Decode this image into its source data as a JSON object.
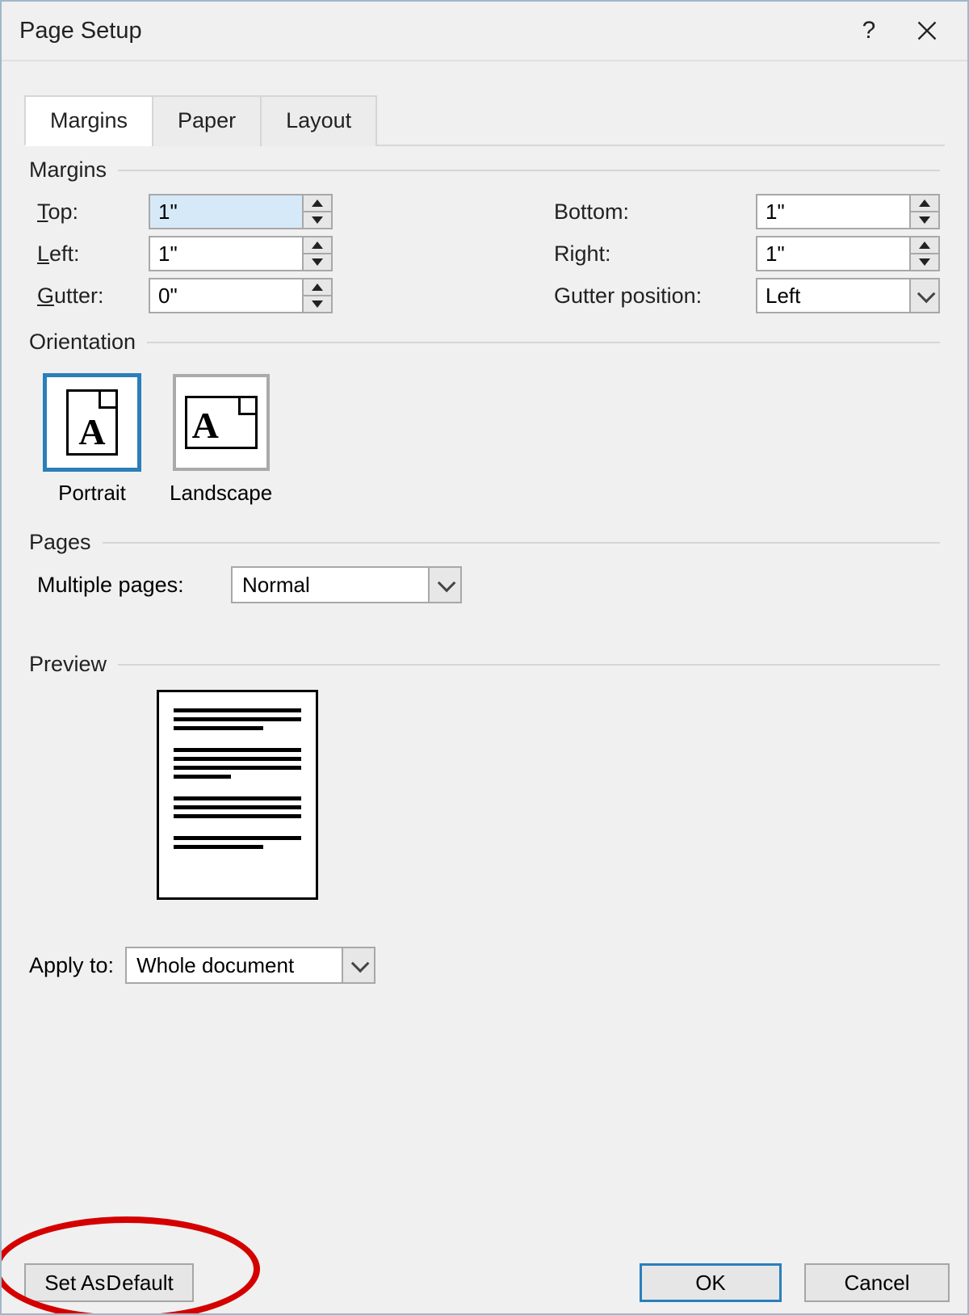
{
  "dialog": {
    "title": "Page Setup"
  },
  "tabs": [
    {
      "label": "Margins",
      "active": true
    },
    {
      "label": "Paper",
      "active": false
    },
    {
      "label": "Layout",
      "active": false
    }
  ],
  "margins": {
    "section_label": "Margins",
    "top": {
      "label_pre": "",
      "key": "T",
      "label_post": "op:",
      "value": "1\""
    },
    "bottom": {
      "label_pre": "",
      "key": "B",
      "label_post": "ottom:",
      "value": "1\""
    },
    "left": {
      "label_pre": "",
      "key": "L",
      "label_post": "eft:",
      "value": "1\""
    },
    "right": {
      "label_pre": "",
      "key": "R",
      "label_post": "ight:",
      "value": "1\""
    },
    "gutter": {
      "label_pre": "",
      "key": "G",
      "label_post": "utter:",
      "value": "0\""
    },
    "gutter_position": {
      "label": "Gutter position:",
      "key": "u",
      "value": "Left"
    }
  },
  "orientation": {
    "section_label": "Orientation",
    "portrait": {
      "label": "Portrait",
      "key": "P",
      "selected": true
    },
    "landscape": {
      "label": "Landscape",
      "key": "s",
      "selected": false
    }
  },
  "pages": {
    "section_label": "Pages",
    "multiple": {
      "label": "Multiple pages:",
      "key": "M",
      "value": "Normal"
    }
  },
  "preview": {
    "section_label": "Preview"
  },
  "apply": {
    "label": "Apply to:",
    "value": "Whole document"
  },
  "buttons": {
    "set_default": "Set As Default",
    "set_default_key": "D",
    "ok": "OK",
    "cancel": "Cancel"
  }
}
